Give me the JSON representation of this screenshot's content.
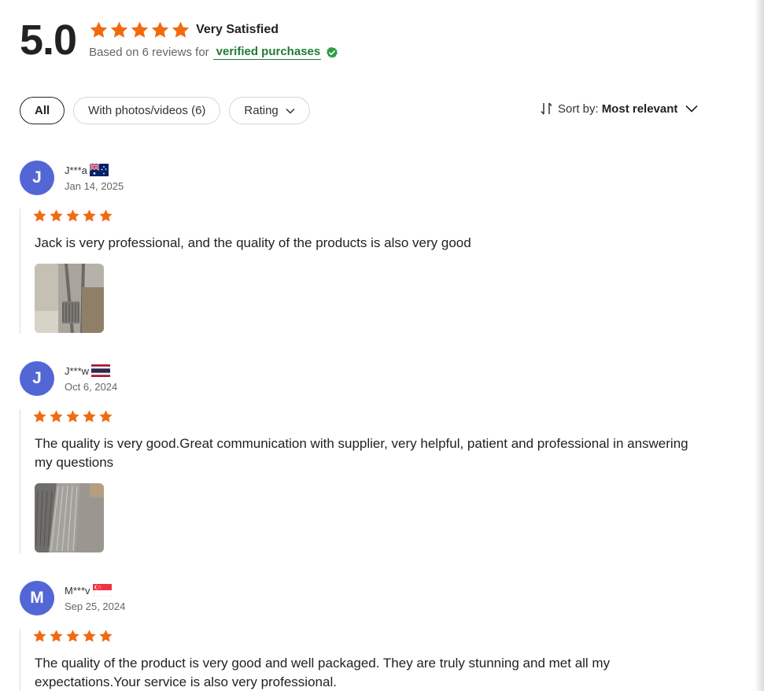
{
  "summary": {
    "score": "5.0",
    "rating": 5,
    "satisfaction": "Very Satisfied",
    "based_on": "Based on 6 reviews for",
    "verified": "verified purchases",
    "verified_icon": "verified-check-icon",
    "star_color": "#f26a10"
  },
  "filters": {
    "all": "All",
    "photos": "With photos/videos (6)",
    "rating": "Rating"
  },
  "sort": {
    "label": "Sort by:",
    "value": "Most relevant",
    "icon": "sort-arrows-icon"
  },
  "reviews": [
    {
      "initial": "J",
      "name": "J***a",
      "flag": "australia-flag-icon",
      "date": "Jan 14, 2025",
      "rating": 5,
      "text": "Jack is very professional, and the quality of the products is also very good"
    },
    {
      "initial": "J",
      "name": "J***w",
      "flag": "thailand-flag-icon",
      "date": "Oct 6, 2024",
      "rating": 5,
      "text": "The quality is very good.Great communication with supplier, very helpful, patient and professional in answering my questions"
    },
    {
      "initial": "M",
      "name": "M***v",
      "flag": "singapore-flag-icon",
      "date": "Sep 25, 2024",
      "rating": 5,
      "text": "The quality of the product is very good and well packaged. They are truly stunning and met all my expectations.Your service is also very professional."
    }
  ],
  "colors": {
    "avatar": "#5366d6",
    "verified_green": "#1f7a34"
  }
}
